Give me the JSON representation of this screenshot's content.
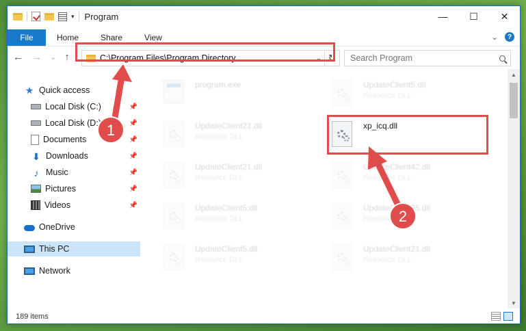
{
  "window": {
    "title": "Program",
    "qa_dropdown": "▾",
    "minimize": "—",
    "maximize": "☐",
    "close": "✕"
  },
  "ribbon": {
    "tabs": [
      "File",
      "Home",
      "Share",
      "View"
    ],
    "expand": "⌄",
    "help": "?"
  },
  "nav": {
    "back": "←",
    "forward": "→",
    "recent": "⌄",
    "up": "↑",
    "address": "C:\\Program Files\\Program Directory",
    "address_dropdown": "⌄",
    "refresh": "↻",
    "search_placeholder": "Search Program"
  },
  "sidebar": {
    "pin": "📌",
    "items": [
      {
        "label": "Quick access",
        "icon": "star-icon",
        "pinned": false
      },
      {
        "label": "Local Disk (C:)",
        "icon": "drive-icon",
        "pinned": true
      },
      {
        "label": "Local Disk (D:)",
        "icon": "drive-icon",
        "pinned": true
      },
      {
        "label": "Documents",
        "icon": "documents-icon",
        "pinned": true
      },
      {
        "label": "Downloads",
        "icon": "download-icon",
        "pinned": true
      },
      {
        "label": "Music",
        "icon": "music-icon",
        "pinned": true
      },
      {
        "label": "Pictures",
        "icon": "pictures-icon",
        "pinned": true
      },
      {
        "label": "Videos",
        "icon": "videos-icon",
        "pinned": true
      },
      {
        "label": "OneDrive",
        "icon": "cloud-icon",
        "pinned": false
      },
      {
        "label": "This PC",
        "icon": "computer-icon",
        "pinned": false,
        "selected": true
      },
      {
        "label": "Network",
        "icon": "network-icon",
        "pinned": false
      }
    ]
  },
  "files": [
    {
      "name": "program.exe",
      "type": "",
      "kind": "exe",
      "faded": true
    },
    {
      "name": "UpdateClient5.dll",
      "type": "Resource DLL",
      "kind": "dll",
      "faded": true
    },
    {
      "name": "UpdateClient21.dll",
      "type": "Resource DLL",
      "kind": "dll",
      "faded": true
    },
    {
      "name": "xp_icq.dll",
      "type": "",
      "kind": "dll",
      "faded": false
    },
    {
      "name": "UpdateClient21.dll",
      "type": "Resource DLL",
      "kind": "dll",
      "faded": true
    },
    {
      "name": "UpdateClient42.dll",
      "type": "Resource DLL",
      "kind": "dll",
      "faded": true
    },
    {
      "name": "UpdateClient5.dll",
      "type": "Resource DLL",
      "kind": "dll",
      "faded": true
    },
    {
      "name": "UpdateClient65.dll",
      "type": "Resource DLL",
      "kind": "dll",
      "faded": true
    },
    {
      "name": "UpdateClient5.dll",
      "type": "Resource DLL",
      "kind": "dll",
      "faded": true
    },
    {
      "name": "UpdateClient21.dll",
      "type": "Resource DLL",
      "kind": "dll",
      "faded": true
    }
  ],
  "scrollbar": {
    "up": "▲",
    "down": "▼"
  },
  "status": {
    "item_count": "189 items"
  },
  "annotations": {
    "step1": "1",
    "step2": "2",
    "color": "#e04b4b"
  }
}
